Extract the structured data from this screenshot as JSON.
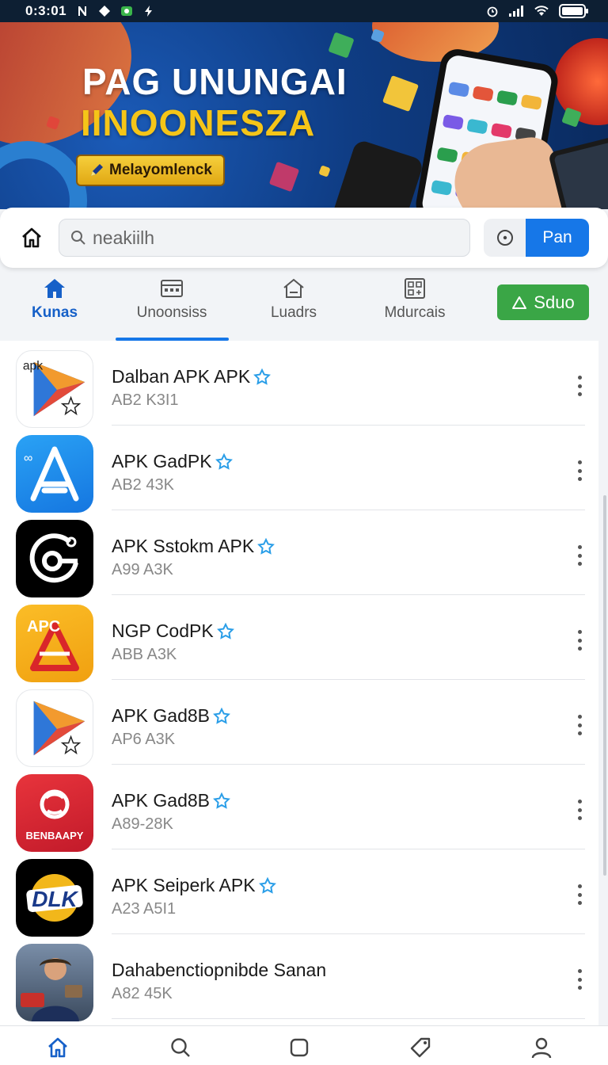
{
  "status_bar": {
    "time": "0:3:01",
    "left_icons": [
      "n-icon",
      "diamond-icon",
      "gallery-icon",
      "bolt-icon"
    ],
    "right_icons": [
      "alarm-icon",
      "signal-icon",
      "wifi-icon",
      "battery-icon"
    ]
  },
  "banner": {
    "title_line1": "PAG UNUNGAI",
    "title_line2": "IINOONESZA",
    "badge_label": "Melayomlenck",
    "colors": {
      "title": "#ffffff",
      "title2": "#f5c518",
      "badge": "#f0c22c"
    }
  },
  "search": {
    "placeholder": "neakiilh",
    "go_label": "Pan",
    "accent": "#1677e8"
  },
  "tabs": [
    {
      "label": "Kunas",
      "icon": "home-icon",
      "active": true
    },
    {
      "label": "Unoonsiss",
      "icon": "browser-icon",
      "active": false
    },
    {
      "label": "Luadrs",
      "icon": "house-outline-icon",
      "active": false
    },
    {
      "label": "Mdurcais",
      "icon": "grid-icon",
      "active": false
    }
  ],
  "submit_button": {
    "label": "Sduo",
    "color": "#3aa646"
  },
  "apps": [
    {
      "name": "Dalban APK APK",
      "meta": "AB2 K3I1",
      "verified": true,
      "icon": "play-triangle-icon"
    },
    {
      "name": "APK GadPK",
      "meta": "AB2 43K",
      "verified": true,
      "icon": "app-store-a-icon"
    },
    {
      "name": "APK Sstokm APK",
      "meta": "A99 A3K",
      "verified": true,
      "icon": "camera-ring-icon"
    },
    {
      "name": "NGP CodPK",
      "meta": "ABB A3K",
      "verified": true,
      "icon": "apc-triangle-icon"
    },
    {
      "name": "APK Gad8B",
      "meta": "AP6 A3K",
      "verified": true,
      "icon": "play-triangle-icon"
    },
    {
      "name": "APK Gad8B",
      "meta": "A89-28K",
      "verified": true,
      "icon": "benbaapy-icon"
    },
    {
      "name": "APK Seiperk APK",
      "meta": "A23 A5I1",
      "verified": true,
      "icon": "dlk-logo-icon"
    },
    {
      "name": "Dahabenctiopnibde Sanan",
      "meta": "A82 45K",
      "verified": false,
      "icon": "person-photo-icon"
    }
  ],
  "app_icon_texts": {
    "apk": "apk",
    "apc": "APC",
    "benbaapy": "BENBAAPY",
    "dlk": "DLK"
  },
  "bottom_nav": [
    {
      "icon": "home-icon",
      "active": true
    },
    {
      "icon": "search-icon",
      "active": false
    },
    {
      "icon": "square-icon",
      "active": false
    },
    {
      "icon": "tag-icon",
      "active": false
    },
    {
      "icon": "profile-icon",
      "active": false
    }
  ]
}
